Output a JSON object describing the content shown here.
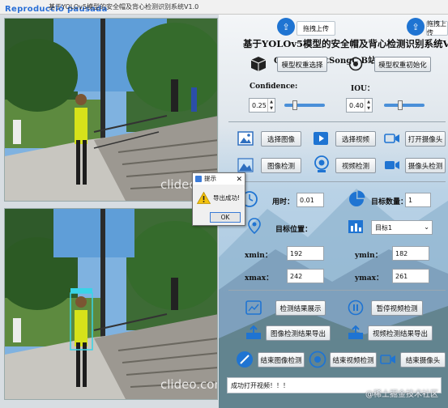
{
  "window": {
    "title": "基于YOLOv5模型的安全帽及背心检测识别系统V1.0",
    "overlay_status": "Reproducció pausada"
  },
  "videos": {
    "watermark": "clideo.com"
  },
  "header": {
    "upload_label": "拖拽上传",
    "title": "基于YOLOv5模型的安全帽及背心检测识别系统V1.0",
    "subtitle": "CSDN：BestSongC    B站：Bestsongc"
  },
  "model": {
    "select_label": "模型权重选择",
    "init_label": "模型权重初始化",
    "confidence_label": "Confidence:",
    "confidence_value": "0.25",
    "confidence_level": 0.25,
    "iou_label": "IOU：",
    "iou_value": "0.40",
    "iou_level": 0.4
  },
  "sources": {
    "select_image": "选择图像",
    "select_video": "选择视频",
    "open_camera": "打开摄像头",
    "image_detect": "图像检测",
    "video_detect": "视频检测",
    "camera_detect": "摄像头检测"
  },
  "results": {
    "time_label": "用时：",
    "time_value": "0.01",
    "count_label": "目标数量：",
    "count_value": "1",
    "position_label": "目标位置：",
    "target_select": "目标1",
    "xmin_label": "xmin：",
    "xmin_value": "192",
    "ymin_label": "ymin：",
    "ymin_value": "182",
    "xmax_label": "xmax：",
    "xmax_value": "242",
    "ymax_label": "ymax：",
    "ymax_value": "261"
  },
  "actions": {
    "show_results": "检测结果展示",
    "pause_video": "暂停视频检测",
    "export_image": "图像检测结果导出",
    "export_video": "视频检测结果导出",
    "end_image": "结束图像检测",
    "end_video": "结束视频检测",
    "end_camera": "结束摄像头"
  },
  "status": {
    "text": "成功打开视频！！！",
    "watermark": "@稀土掘金技术社区"
  },
  "dialog": {
    "title": "提示",
    "message": "导出成功!",
    "ok_label": "OK"
  },
  "colors": {
    "accent": "#1f74d2",
    "sky": "#7fb2e0",
    "vest": "#d6e21a"
  }
}
